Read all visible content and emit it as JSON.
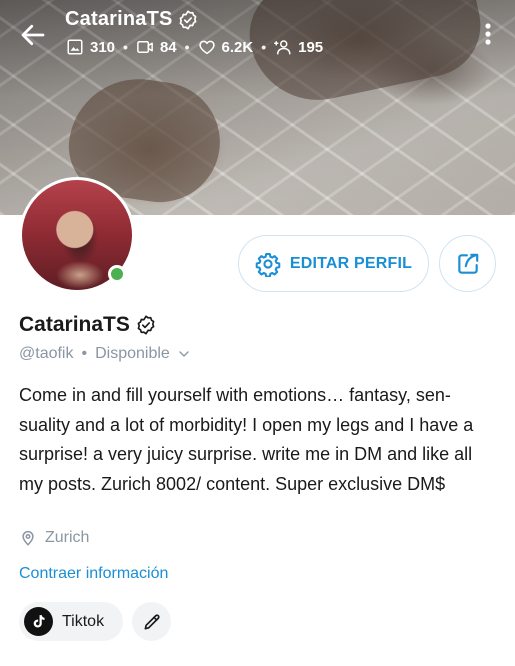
{
  "header": {
    "title": "CatarinaTS",
    "stats": {
      "photos": "310",
      "videos": "84",
      "likes": "6.2K",
      "fans": "195"
    },
    "separator": "•"
  },
  "actions": {
    "edit_profile_label": "EDITAR PERFIL"
  },
  "profile": {
    "name": "CatarinaTS",
    "handle": "@taofik",
    "separator": "•",
    "status": "Disponible",
    "online": true,
    "bio": "Come in and fill yourself with emotions… fantasy, sen-suality and a lot of morbidity! I open my legs and I have a surprise! a very juicy surprise. write me in DM and like all my posts. Zurich 8002/ content. Super exclusive DM$",
    "location": "Zurich",
    "collapse_label": "Contraer información"
  },
  "social_links": [
    {
      "label": "Tiktok",
      "icon": "tiktok-icon"
    }
  ],
  "colors": {
    "accent": "#1a8fd4",
    "muted": "#8a96a3",
    "online": "#4caf50",
    "chip_bg": "#f1f3f5"
  }
}
